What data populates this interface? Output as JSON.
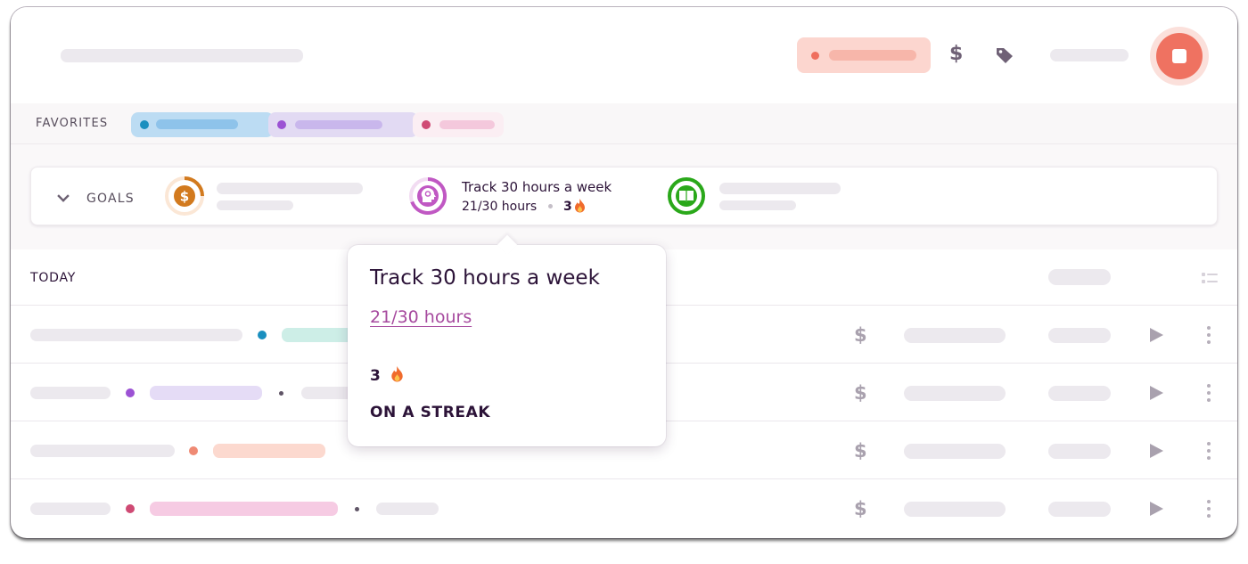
{
  "colors": {
    "accent_red": "#ef7261",
    "fav_blue": "#bcdcf3",
    "fav_purple": "#e2daf3",
    "fav_pink": "#fbeef3",
    "goal_orange": "#d27a1e",
    "goal_purple": "#c058c3",
    "goal_green": "#2aa81a",
    "link_purple": "#a6499e"
  },
  "header": {
    "icons": [
      "dollar-icon",
      "tag-icon",
      "stop-icon"
    ]
  },
  "favorites": {
    "label": "FAVORITES"
  },
  "goals": {
    "label": "GOALS",
    "items": [
      {
        "icon": "dollar-coin-icon"
      },
      {
        "icon": "meditation-head-icon",
        "title": "Track 30 hours a week",
        "progress": "21/30 hours",
        "streak": "3",
        "progress_value": 0.7
      },
      {
        "icon": "book-icon"
      }
    ]
  },
  "list": {
    "label": "TODAY",
    "row_icons": [
      "dollar-icon",
      "play-icon",
      "more-icon"
    ]
  },
  "popover": {
    "title": "Track 30 hours a week",
    "progress_link": "21/30 hours",
    "streak_count": "3",
    "streak_label": "ON A STREAK"
  }
}
